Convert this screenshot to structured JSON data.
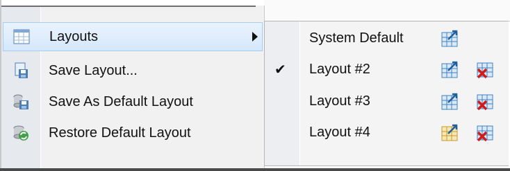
{
  "menu": {
    "items": [
      {
        "label": "Layouts",
        "icon": "layouts-grid-icon",
        "has_submenu": true
      },
      {
        "label": "Save Layout...",
        "icon": "save-layout-icon"
      },
      {
        "label": "Save As Default Layout",
        "icon": "save-as-default-icon"
      },
      {
        "label": "Restore Default Layout",
        "icon": "restore-default-icon"
      }
    ]
  },
  "submenu": {
    "items": [
      {
        "label": "System Default",
        "checked": false
      },
      {
        "label": "Layout #2",
        "checked": true
      },
      {
        "label": "Layout #3",
        "checked": false
      },
      {
        "label": "Layout #4",
        "checked": false
      }
    ],
    "check_glyph": "✔"
  },
  "colors": {
    "highlight_border": "#a9cdf2",
    "delete_red": "#d21a1a",
    "grid_blue": "#3b82c8"
  }
}
